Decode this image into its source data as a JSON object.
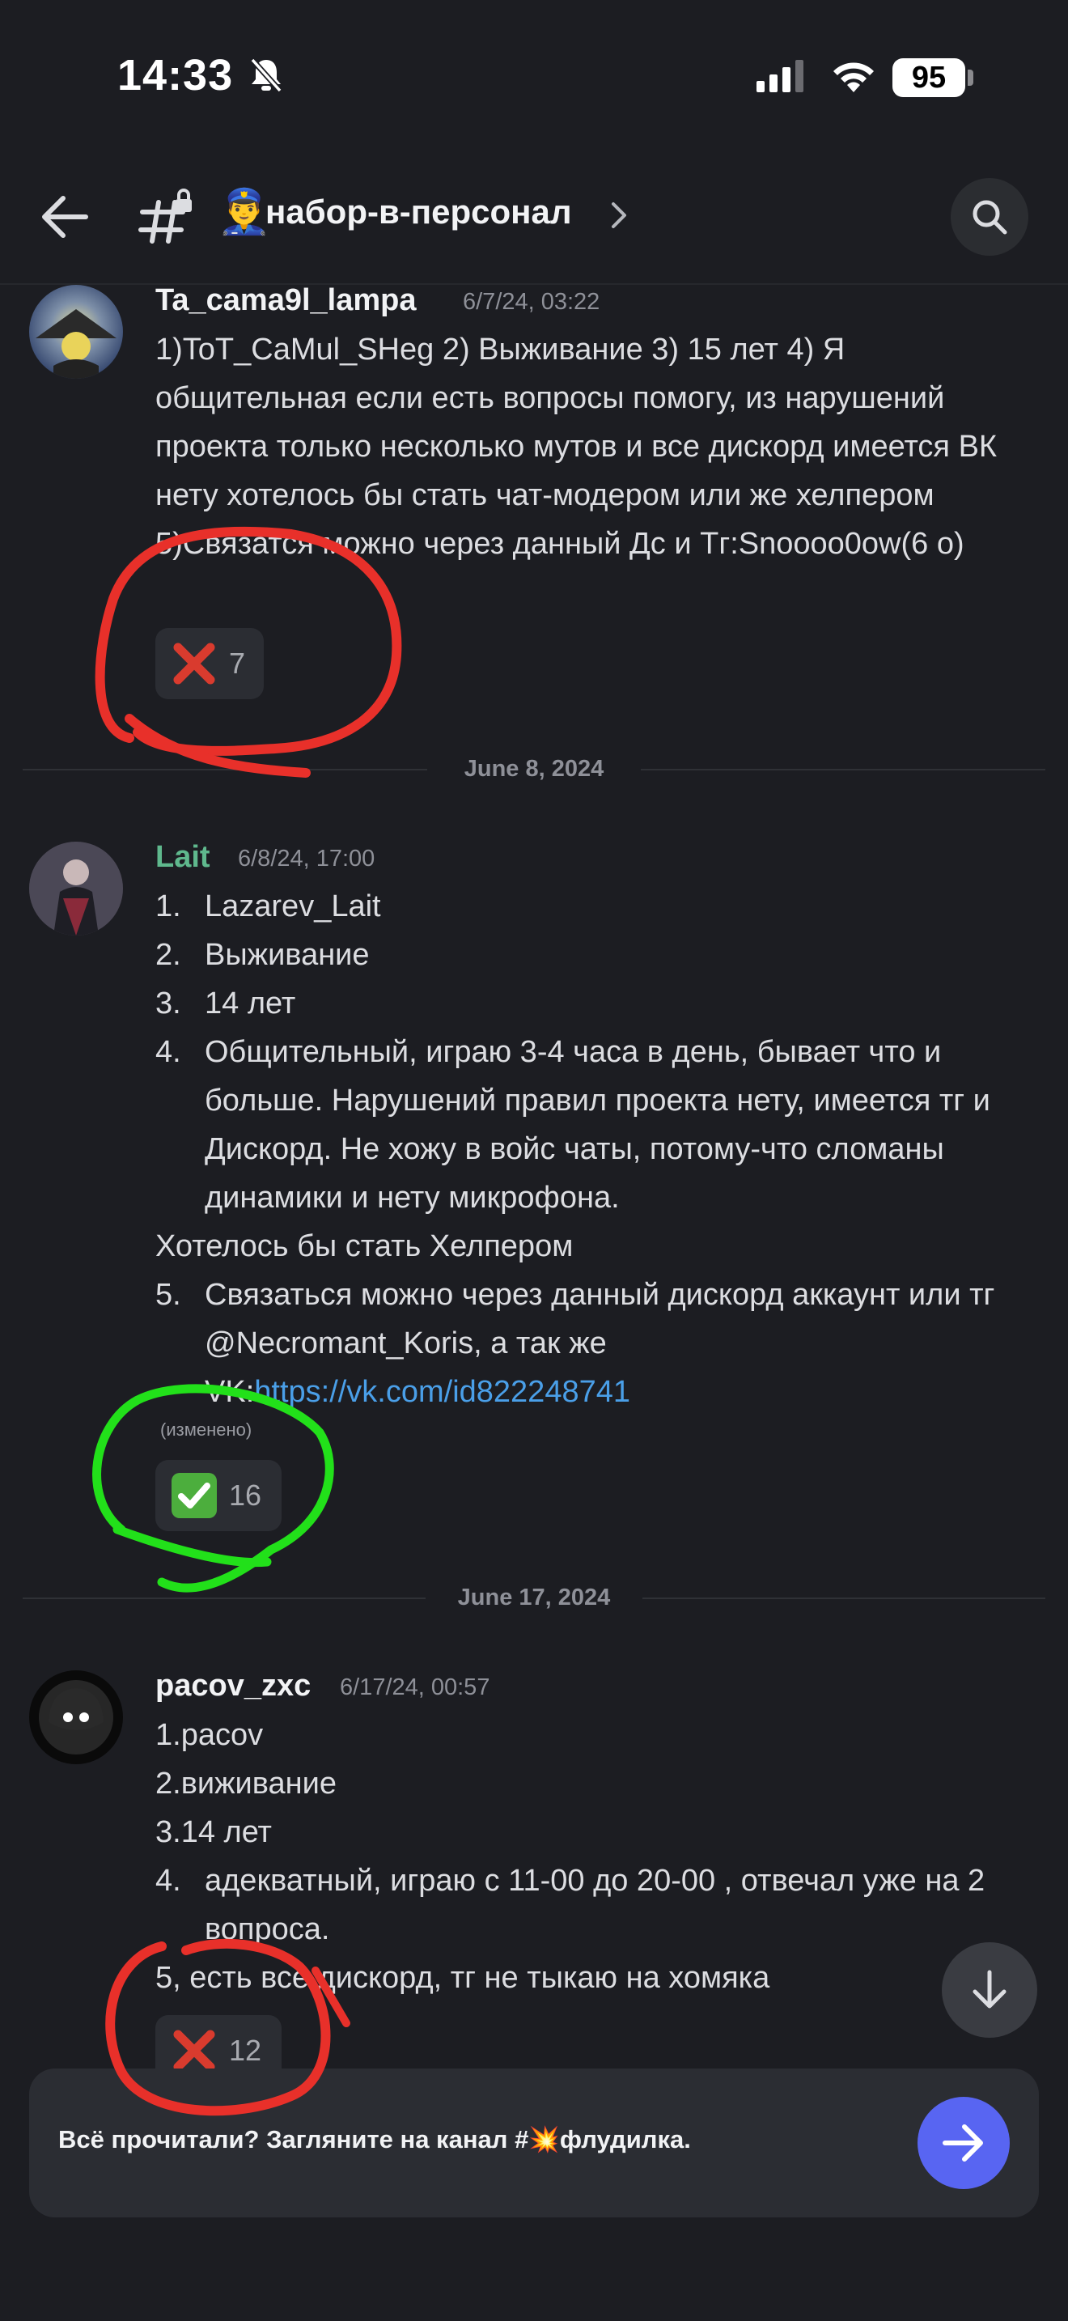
{
  "status_bar": {
    "time": "14:33",
    "battery": "95"
  },
  "header": {
    "emoji": "👮‍♂️",
    "channel_name": "набор-в-персонал"
  },
  "messages": [
    {
      "author": "Ta_cama9l_lampa",
      "timestamp": "6/7/24, 03:22",
      "text": "1)ToT_CaMul_SHeg 2) Выживание 3) 15 лет 4) Я общительная если есть вопросы помогу, из нарушений проекта только несколько мутов и все дискорд имеется ВК нету хотелось бы стать чат-модером или же хелпером 5)Связатся можно через данный Дс  и Тг:Snoooo0ow(6 o)",
      "reaction": {
        "emoji": "❌",
        "count": "7"
      }
    },
    {
      "author": "Lait",
      "timestamp": "6/8/24, 17:00",
      "items": [
        {
          "n": "1.",
          "text": "Lazarev_Lait"
        },
        {
          "n": "2.",
          "text": "Выживание"
        },
        {
          "n": "3.",
          "text": "14 лет"
        },
        {
          "n": "4.",
          "text": "Общительный, играю 3-4 часа в день, бывает  что и больше. Нарушений правил проекта нету, имеется тг и Дискорд.  Не хожу в войс чаты, потому-что сломаны динамики и нету микрофона."
        }
      ],
      "extra": "Хотелось бы стать Хелпером",
      "item5": {
        "n": "5.",
        "text": "Связаться можно через данный дискорд аккаунт или тг @Necromant_Koris, а так же VK:",
        "link": "https://vk.com/id822248741"
      },
      "edited": "(изменено)",
      "reaction": {
        "emoji": "✅",
        "count": "16"
      }
    },
    {
      "author": "pacov_zxc",
      "timestamp": "6/17/24, 00:57",
      "line1": "1.pacov",
      "line2": "2.виживание",
      "line3": "3.14 лет",
      "item4": {
        "n": "4.",
        "text": "адекватный, играю с 11-00 до 20-00 , отвечал уже на 2 вопроса."
      },
      "line5": "5, есть все,дискорд, тг  не тыкаю на хомяка",
      "reaction": {
        "emoji": "❌",
        "count": "12"
      }
    }
  ],
  "dividers": [
    "June 8, 2024",
    "June 17, 2024"
  ],
  "banner": {
    "text": "Всё прочитали? Загляните на канал #💥флудилка."
  },
  "colors": {
    "background": "#1c1d22",
    "accent": "#5865f2",
    "link": "#4a9fe8",
    "username_green": "#5fb88d",
    "annotation_red": "#e8302a",
    "annotation_green": "#22e01a"
  }
}
